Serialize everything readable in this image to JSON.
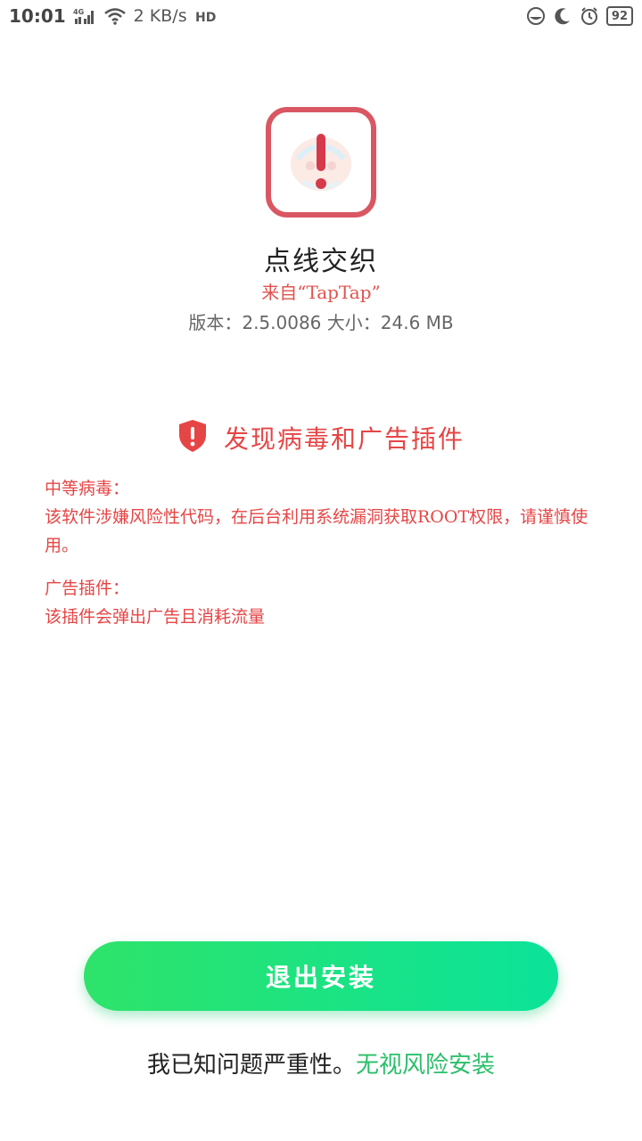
{
  "status_bar": {
    "time": "10:01",
    "network_label": "4G",
    "speed": "2 KB/s",
    "hd_label": "HD",
    "battery": "92"
  },
  "app": {
    "name": "点线交织",
    "source": "来自“TapTap”",
    "meta": "版本：2.5.0086  大小：24.6 MB"
  },
  "warning": {
    "title": "发现病毒和广告插件",
    "items": [
      {
        "title": "中等病毒：",
        "body": "该软件涉嫌风险性代码，在后台利用系统漏洞获取ROOT权限，请谨慎使用。"
      },
      {
        "title": "广告插件：",
        "body": "该插件会弹出广告且消耗流量"
      }
    ]
  },
  "actions": {
    "exit_label": "退出安装",
    "notice": "我已知问题严重性。",
    "ignore_label": "无视风险安装"
  },
  "colors": {
    "danger": "#e64545",
    "icon_border": "#d95763",
    "accent_green": "#2bbf6a",
    "button_start": "#2ee36a",
    "button_end": "#0be39a"
  },
  "icons": {
    "shield": "shield-exclamation-icon",
    "app_warning": "exclamation-icon"
  }
}
